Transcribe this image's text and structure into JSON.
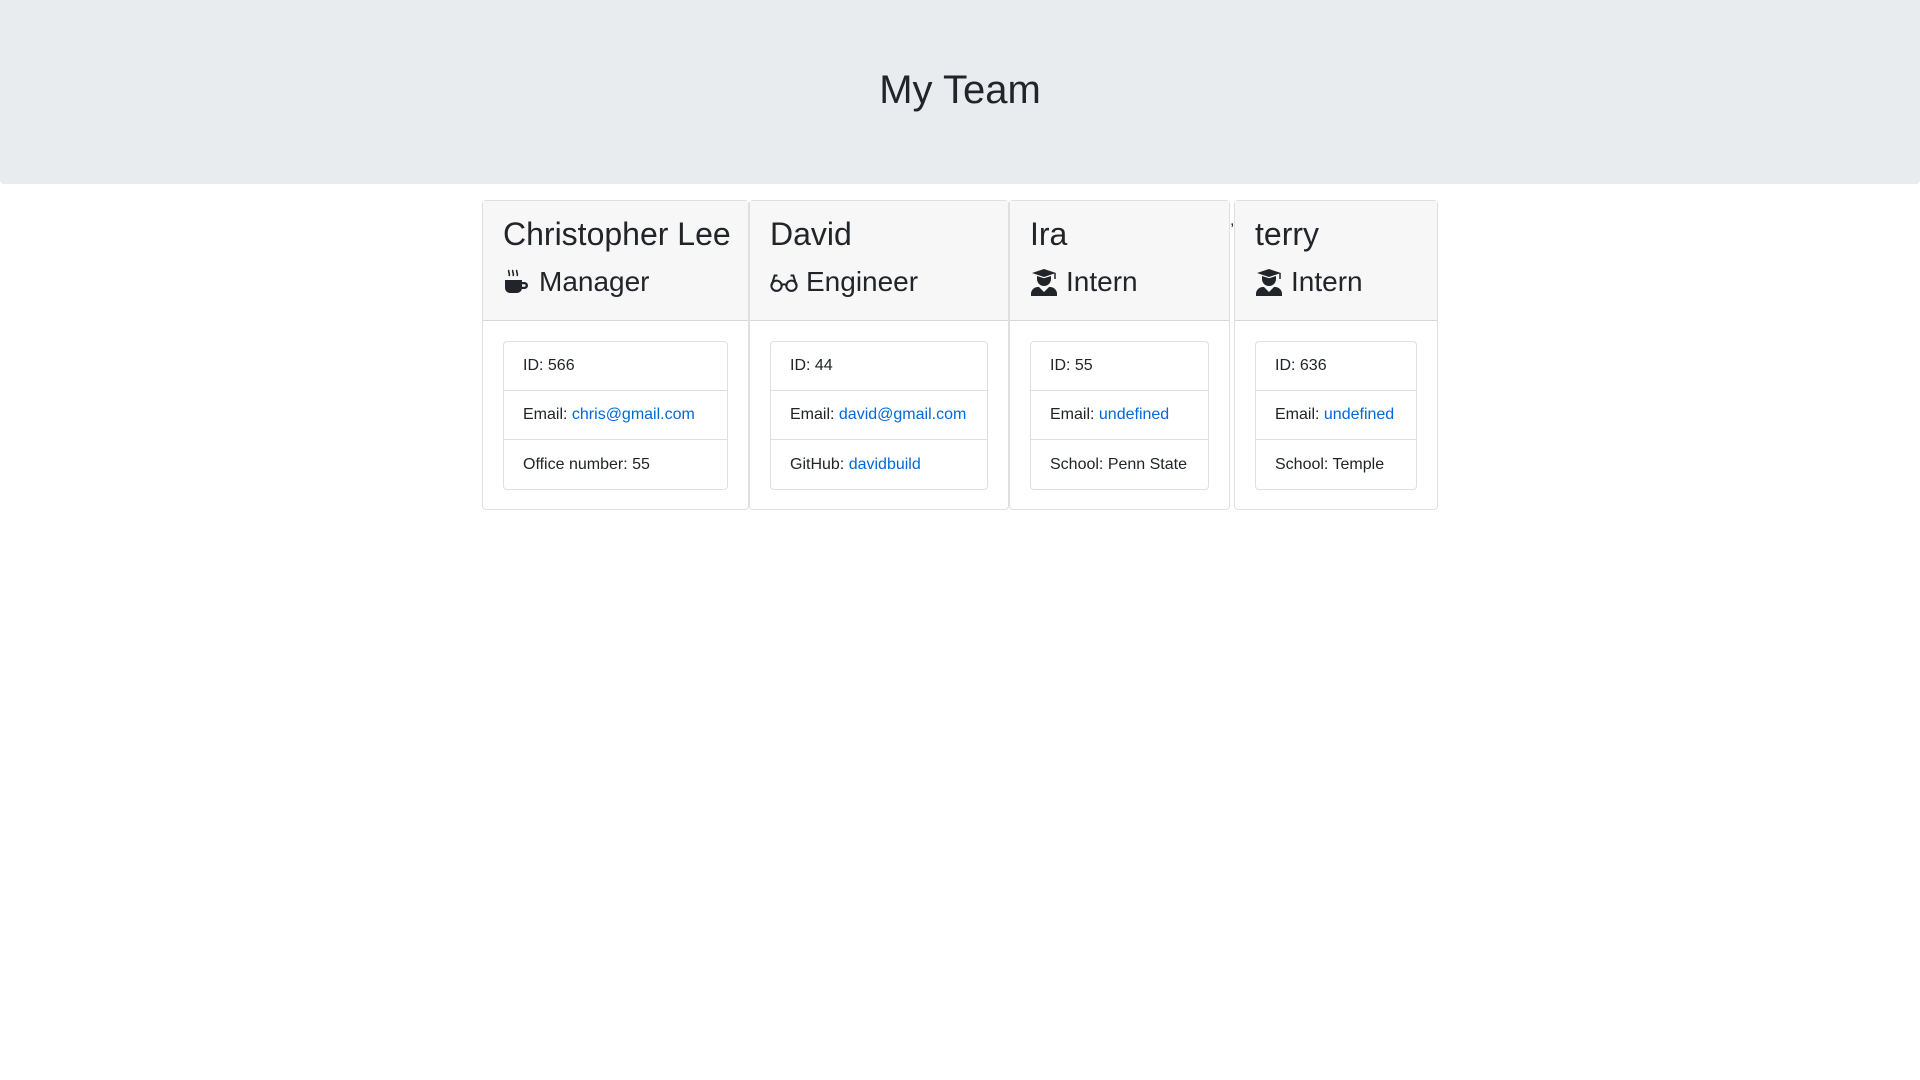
{
  "header": {
    "title": "My Team"
  },
  "members": [
    {
      "name": "Christopher Lee",
      "role": "Manager",
      "role_icon": "coffee-mug-icon",
      "id_text": "ID: 566",
      "email_label": "Email: ",
      "email": "chris@gmail.com",
      "extra_label": "Office number: 55",
      "extra_link": ""
    },
    {
      "name": "David",
      "role": "Engineer",
      "role_icon": "glasses-icon",
      "id_text": "ID: 44",
      "email_label": "Email: ",
      "email": "david@gmail.com",
      "extra_label": "GitHub: ",
      "extra_link": "davidbuild"
    },
    {
      "name": "Ira",
      "role": "Intern",
      "role_icon": "graduate-icon",
      "id_text": "ID: 55",
      "email_label": "Email: ",
      "email": "undefined",
      "extra_label": "School: Penn State",
      "extra_link": ""
    },
    {
      "name": "terry",
      "role": "Intern",
      "role_icon": "graduate-icon",
      "id_text": "ID: 636",
      "email_label": "Email: ",
      "email": "undefined",
      "extra_label": "School: Temple",
      "extra_link": ""
    }
  ],
  "stray_mark": ","
}
